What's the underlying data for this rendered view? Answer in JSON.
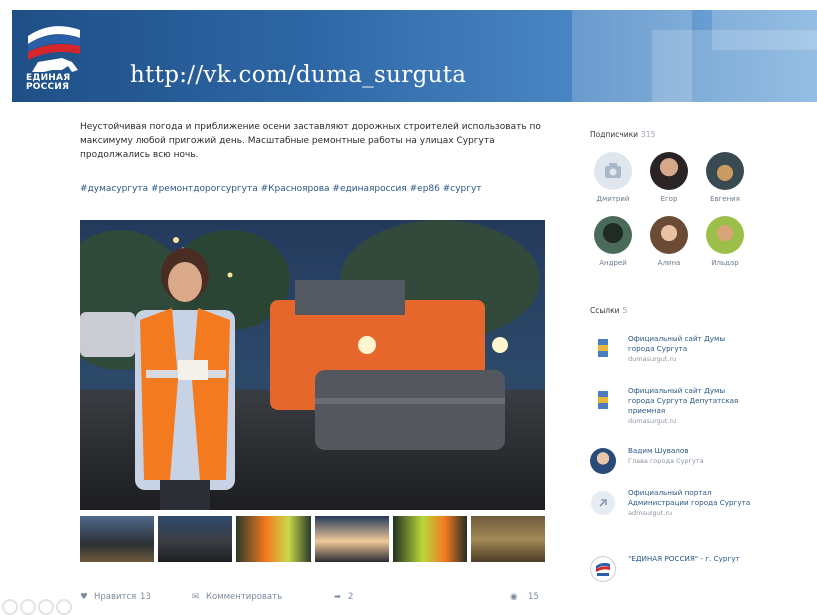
{
  "banner": {
    "logo_text_line1": "ЕДИНАЯ",
    "logo_text_line2": "РОССИЯ",
    "url": "http://vk.com/duma_surguta"
  },
  "post": {
    "text": "Неустойчивая погода и приближение осени заставляют дорожных строителей использовать по максимуму любой пригожий день. Масштабные ремонтные работы на улицах Сургута продолжались всю ночь.",
    "hashtags": "#думасургута #ремонтдорогсургута #Красноярова #единаяроссия #ер86 #сургут",
    "actions": {
      "like_label": "Нравится",
      "like_count": "13",
      "comment_label": "Комментировать",
      "repost_count": "2",
      "views": "15"
    }
  },
  "subscribers": {
    "title": "Подписчики",
    "count": "315",
    "people": [
      "Дмитрий",
      "Егор",
      "Евгения",
      "Андрей",
      "Алина",
      "Ильдар"
    ]
  },
  "links": {
    "title": "Ссылки",
    "count": "5",
    "items": [
      {
        "title": "Официальный сайт Думы города Сургута",
        "sub": "dumasurgut.ru"
      },
      {
        "title": "Официальный сайт Думы города Сургута Депутатская приемная",
        "sub": "dumasurgut.ru"
      },
      {
        "title": "Вадим Шувалов",
        "sub": "Глава города Сургута"
      },
      {
        "title": "Официальный портал Администрации города Сургута",
        "sub": "admsurgut.ru"
      },
      {
        "title": "\"ЕДИНАЯ РОССИЯ\" - г. Сургут",
        "sub": ""
      }
    ]
  },
  "colors": {
    "banner_dark": "#1f4f86",
    "banner_light": "#7fb0dd",
    "link_blue": "#2a5885",
    "vest_orange": "#f47a1f"
  }
}
